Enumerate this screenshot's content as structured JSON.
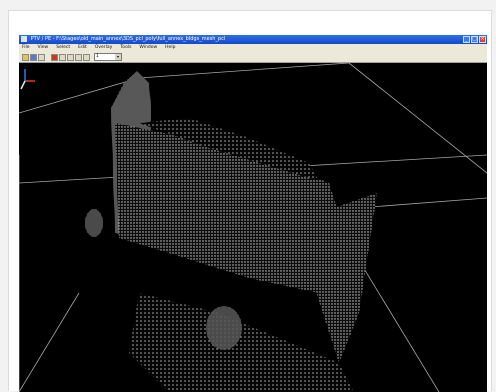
{
  "window": {
    "title": "PTV / PE - F:\\Stages\\old_main_annex\\3DS_pcl_poly\\full_annex_bldgs_mesh_pcl",
    "controls": {
      "minimize": "_",
      "maximize": "□",
      "close": "×"
    }
  },
  "menu": {
    "items": [
      "File",
      "View",
      "Select",
      "Edit",
      "Overlay",
      "Tools",
      "Window",
      "Help"
    ]
  },
  "toolbar": {
    "buttons": [
      "open-icon",
      "save-icon",
      "grid-icon",
      "record-icon",
      "cursor-icon",
      "select-box-icon",
      "zoom-icon",
      "pan-icon"
    ],
    "zoom_value": "1"
  },
  "viewport": {
    "background": "#000000",
    "point_color": "#e8e8e8",
    "axis_colors": {
      "x": "#e23a2a",
      "y": "#2a7ae2",
      "z": "#e8e8e8"
    }
  },
  "colors": {
    "titlebar": "#1f5bd8",
    "chrome": "#ece9d8"
  }
}
